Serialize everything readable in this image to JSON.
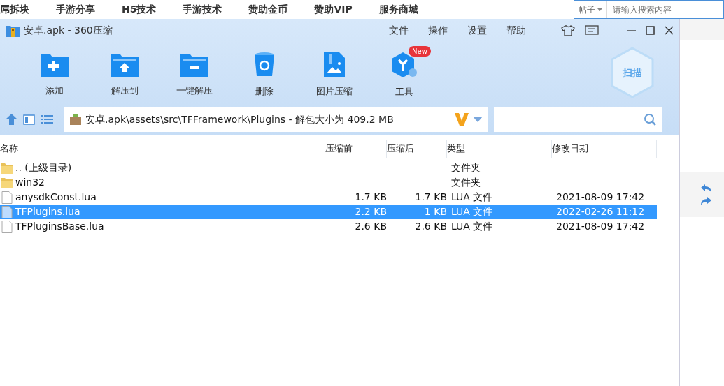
{
  "background_page": {
    "nav_items": [
      "屌拆块",
      "手游分享",
      "H5技术",
      "手游技术",
      "赞助金币",
      "赞助VIP",
      "服务商城"
    ],
    "search": {
      "scope": "帖子",
      "placeholder": "请输入搜索内容"
    }
  },
  "window": {
    "title": "安卓.apk - 360压缩",
    "menu": [
      "文件",
      "操作",
      "设置",
      "帮助"
    ]
  },
  "toolbar": [
    {
      "label": "添加"
    },
    {
      "label": "解压到"
    },
    {
      "label": "一键解压"
    },
    {
      "label": "删除"
    },
    {
      "label": "图片压缩"
    },
    {
      "label": "工具",
      "badge": "New"
    }
  ],
  "scan_button": "扫描",
  "address": {
    "path": "安卓.apk\\assets\\src\\TFFramework\\Plugins - 解包大小为 409.2 MB"
  },
  "table": {
    "columns": [
      "名称",
      "压缩前",
      "压缩后",
      "类型",
      "修改日期"
    ],
    "rows": [
      {
        "kind": "folder",
        "name": ".. (上级目录)",
        "size": "",
        "packed": "",
        "type": "文件夹",
        "modified": "",
        "selected": false
      },
      {
        "kind": "folder",
        "name": "win32",
        "size": "",
        "packed": "",
        "type": "文件夹",
        "modified": "",
        "selected": false
      },
      {
        "kind": "file",
        "name": "anysdkConst.lua",
        "size": "1.7 KB",
        "packed": "1.7 KB",
        "type": "LUA 文件",
        "modified": "2021-08-09 17:42",
        "selected": false
      },
      {
        "kind": "file",
        "name": "TFPlugins.lua",
        "size": "2.2 KB",
        "packed": "1 KB",
        "type": "LUA 文件",
        "modified": "2022-02-26 11:12",
        "selected": true
      },
      {
        "kind": "file",
        "name": "TFPluginsBase.lua",
        "size": "2.6 KB",
        "packed": "2.6 KB",
        "type": "LUA 文件",
        "modified": "2021-08-09 17:42",
        "selected": false
      }
    ]
  }
}
